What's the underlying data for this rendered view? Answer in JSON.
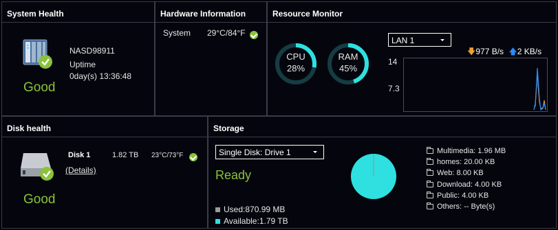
{
  "system_health": {
    "title": "System Health",
    "device_name": "NASD98911",
    "uptime_label": "Uptime",
    "uptime_value": "0day(s) 13:36:48",
    "status": "Good"
  },
  "hardware": {
    "title": "Hardware Information",
    "system_label": "System",
    "system_temp": "29°C/84°F"
  },
  "resource": {
    "title": "Resource Monitor",
    "cpu_label": "CPU",
    "cpu_value": "28%",
    "cpu_fraction": 0.28,
    "ram_label": "RAM",
    "ram_value": "45%",
    "ram_fraction": 0.45,
    "lan_select": "LAN 1",
    "download_rate": "977 B/s",
    "upload_rate": "2 KB/s",
    "y_top": "14",
    "y_mid": "7.3"
  },
  "disk_health": {
    "title": "Disk health",
    "disk_name": "Disk 1",
    "disk_size": "1.82 TB",
    "disk_temp": "23°C/73°F",
    "details_link": "(Details)",
    "status": "Good"
  },
  "storage": {
    "title": "Storage",
    "disk_select": "Single Disk: Drive  1",
    "status": "Ready",
    "used_label": "Used:870.99 MB",
    "available_label": "Available:1.79 TB",
    "folders": [
      {
        "label": "Multimedia: 1.96 MB"
      },
      {
        "label": "homes: 20.00 KB"
      },
      {
        "label": "Web: 8.00 KB"
      },
      {
        "label": "Download: 4.00 KB"
      },
      {
        "label": "Public: 4.00 KB"
      },
      {
        "label": "Others: -- Byte(s)"
      }
    ]
  },
  "colors": {
    "accent": "#2ee0e0",
    "good": "#8ac23a",
    "download_arrow": "#f0a030",
    "upload_arrow": "#2a8cff"
  }
}
